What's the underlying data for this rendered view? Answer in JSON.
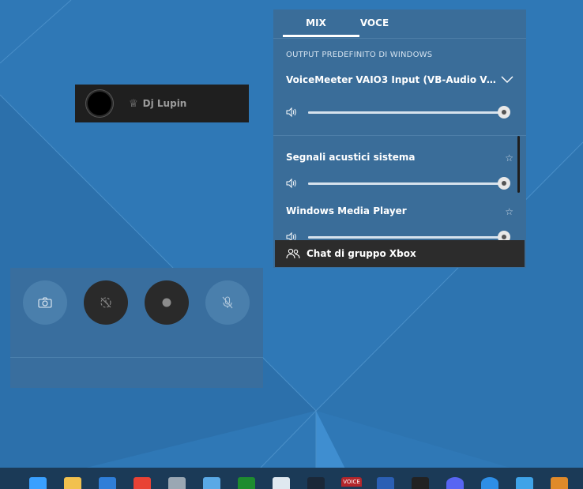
{
  "profile": {
    "gamertag": "Dj Lupin",
    "crown_glyph": "♕"
  },
  "audio": {
    "tabs": [
      {
        "label": "MIX",
        "selected": true
      },
      {
        "label": "VOCE",
        "selected": false
      }
    ],
    "section_label": "OUTPUT PREDEFINITO DI WINDOWS",
    "device_name": "VoiceMeeter VAIO3 Input (VB-Audio Voic...",
    "device_volume": 100,
    "apps": [
      {
        "name": "Segnali acustici sistema",
        "volume": 100
      },
      {
        "name": "Windows Media Player",
        "volume": 100
      }
    ],
    "chat_label": "Chat di gruppo Xbox"
  },
  "capture": {
    "buttons": [
      {
        "name": "screenshot",
        "icon": "camera-icon",
        "style": "light"
      },
      {
        "name": "record-last",
        "icon": "record-last-icon",
        "style": "dark"
      },
      {
        "name": "record",
        "icon": "record-dot-icon",
        "style": "dark"
      },
      {
        "name": "mic",
        "icon": "mic-muted-icon",
        "style": "light"
      }
    ]
  },
  "taskbar": {
    "icons": [
      {
        "name": "windows-start",
        "color": "#3aa0ff"
      },
      {
        "name": "file-explorer",
        "color": "#f2c14e"
      },
      {
        "name": "microsoft-store",
        "color": "#2f7ed8"
      },
      {
        "name": "chrome",
        "color": "#e94235"
      },
      {
        "name": "settings",
        "color": "#9aa7b3"
      },
      {
        "name": "app-blue",
        "color": "#5aa9e6"
      },
      {
        "name": "xbox",
        "color": "#1e8c2f"
      },
      {
        "name": "app-chart",
        "color": "#dfe8f0"
      },
      {
        "name": "steam",
        "color": "#1b2838"
      },
      {
        "name": "voicemeeter",
        "color": "#b3262b"
      },
      {
        "name": "word",
        "color": "#2b5fb4"
      },
      {
        "name": "nvidia",
        "color": "#222222"
      },
      {
        "name": "discord",
        "color": "#5865f2"
      },
      {
        "name": "app-network",
        "color": "#2e8ee6"
      },
      {
        "name": "photos",
        "color": "#3fa3e8"
      },
      {
        "name": "media-player",
        "color": "#e08a2a"
      }
    ],
    "voice_label": "VOICE"
  }
}
